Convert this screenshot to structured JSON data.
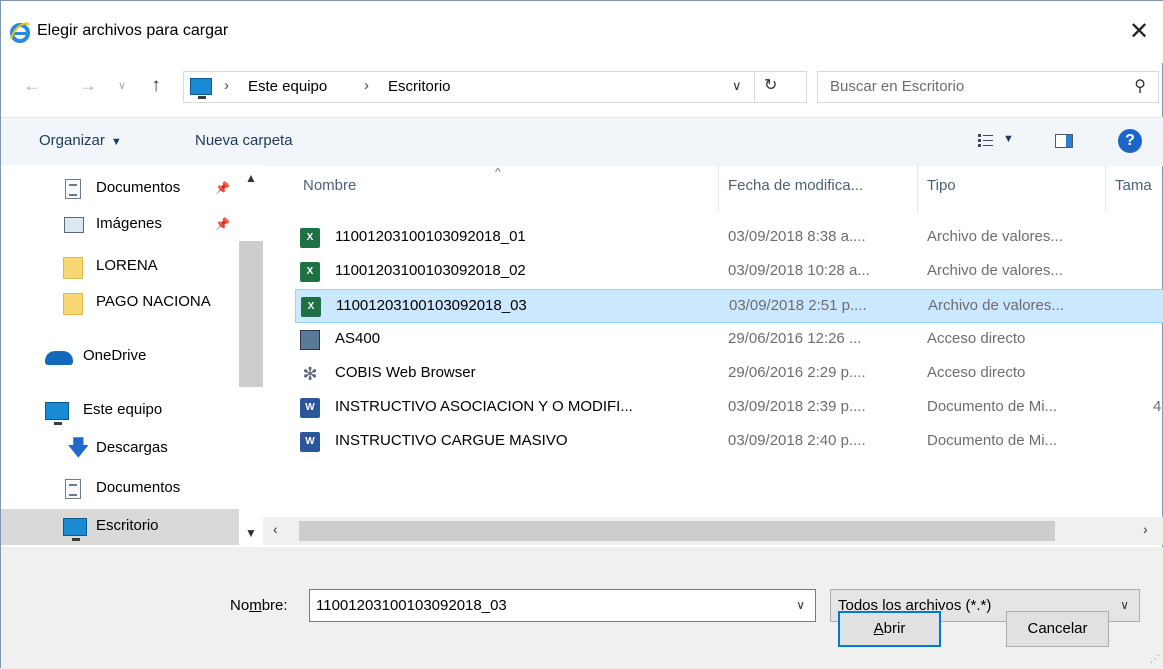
{
  "window": {
    "title": "Elegir archivos para cargar"
  },
  "address": {
    "crumbs": [
      "Este equipo",
      "Escritorio"
    ],
    "separator": "›",
    "search_placeholder": "Buscar en Escritorio"
  },
  "toolbar": {
    "organize": "Organizar",
    "new_folder": "Nueva carpeta"
  },
  "nav_pane": {
    "items": [
      {
        "label": "Documentos",
        "icon": "document-icon",
        "pinned": true
      },
      {
        "label": "Imágenes",
        "icon": "image-icon",
        "pinned": true
      },
      {
        "label": "LORENA",
        "icon": "folder-icon"
      },
      {
        "label": "PAGO NACIONA",
        "icon": "folder-icon"
      },
      {
        "label": "OneDrive",
        "icon": "onedrive-icon"
      },
      {
        "label": "Este equipo",
        "icon": "pc-icon"
      },
      {
        "label": "Descargas",
        "icon": "download-icon"
      },
      {
        "label": "Documentos",
        "icon": "document-icon"
      },
      {
        "label": "Escritorio",
        "icon": "desktop-icon",
        "selected": true
      }
    ]
  },
  "columns": [
    "Nombre",
    "Fecha de modifica...",
    "Tipo",
    "Tama"
  ],
  "files": [
    {
      "name": "11001203100103092018_01",
      "date": "03/09/2018 8:38 a....",
      "type": "Archivo de valores...",
      "size": "",
      "icon": "excel-icon"
    },
    {
      "name": "11001203100103092018_02",
      "date": "03/09/2018 10:28 a...",
      "type": "Archivo de valores...",
      "size": "",
      "icon": "excel-icon"
    },
    {
      "name": "11001203100103092018_03",
      "date": "03/09/2018 2:51 p....",
      "type": "Archivo de valores...",
      "size": "",
      "icon": "excel-icon",
      "selected": true
    },
    {
      "name": "AS400",
      "date": "29/06/2016 12:26 ...",
      "type": "Acceso directo",
      "size": "",
      "icon": "shortcut-icon"
    },
    {
      "name": "COBIS Web Browser",
      "date": "29/06/2016 2:29 p....",
      "type": "Acceso directo",
      "size": "",
      "icon": "gear-icon"
    },
    {
      "name": "INSTRUCTIVO ASOCIACION Y O MODIFI...",
      "date": "03/09/2018 2:39 p....",
      "type": "Documento de Mi...",
      "size": "4",
      "icon": "word-icon"
    },
    {
      "name": "INSTRUCTIVO CARGUE MASIVO",
      "date": "03/09/2018 2:40 p....",
      "type": "Documento de Mi...",
      "size": "",
      "icon": "word-icon"
    }
  ],
  "footer": {
    "name_label_pre": "No",
    "name_label_u": "m",
    "name_label_post": "bre:",
    "name_value": "11001203100103092018_03",
    "filter_value": "Todos los archivos (*.*)",
    "open_button_u": "A",
    "open_button_rest": "brir",
    "cancel_button": "Cancelar"
  },
  "colors": {
    "selection": "#cce8ff",
    "accent": "#0078d7",
    "toolbar_bg": "#f2f6fb"
  }
}
